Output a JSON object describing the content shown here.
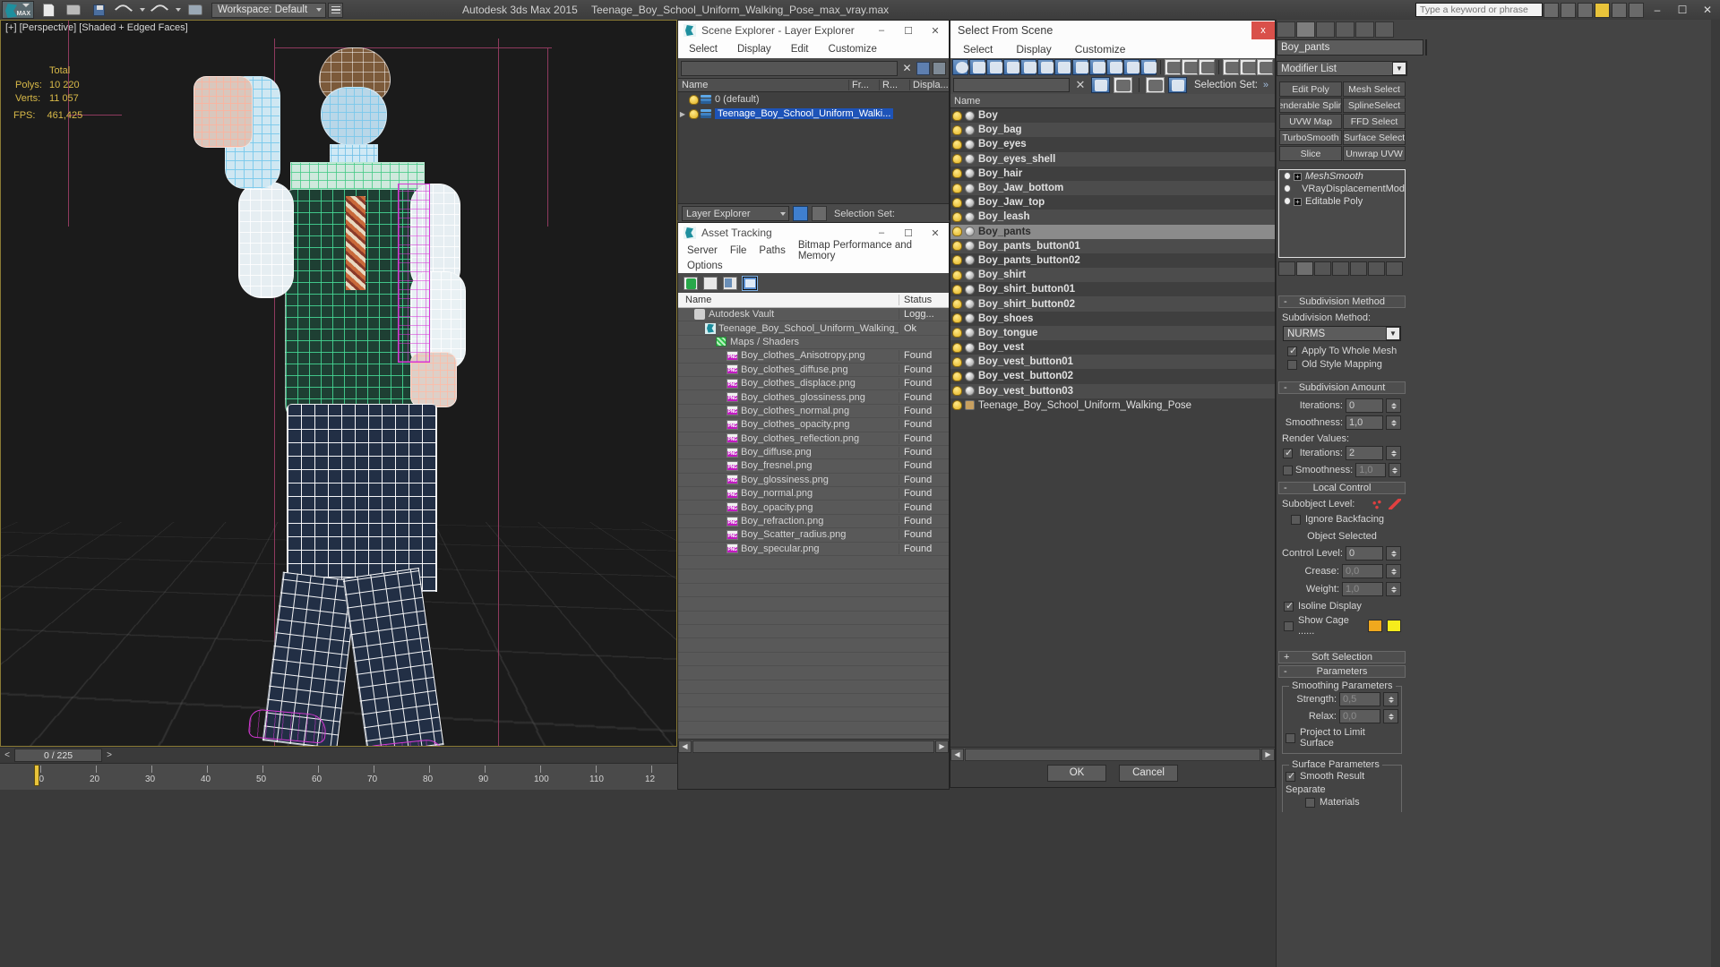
{
  "app": {
    "title": "Autodesk 3ds Max  2015",
    "file": "Teenage_Boy_School_Uniform_Walking_Pose_max_vray.max",
    "workspace_label": "Workspace: Default",
    "keyword_placeholder": "Type a keyword or phrase",
    "win_min": "–",
    "win_max": "☐",
    "win_close": "✕"
  },
  "viewport": {
    "label": "[+] [Perspective] [Shaded + Edged Faces]",
    "stats": {
      "total_header": "Total",
      "polys_label": "Polys:",
      "polys_value": "10 220",
      "verts_label": "Verts:",
      "verts_value": "11 057",
      "fps_label": "FPS:",
      "fps_value": "461,425"
    },
    "timeline": {
      "frame_readout": "0 / 225",
      "prev": "<",
      "next": ">",
      "ticks": [
        "10",
        "20",
        "30",
        "40",
        "50",
        "60",
        "70",
        "80",
        "90",
        "100",
        "110",
        "12"
      ]
    }
  },
  "scene_explorer": {
    "title": "Scene Explorer - Layer Explorer",
    "menus": [
      "Select",
      "Display",
      "Edit",
      "Customize"
    ],
    "column_name": "Name",
    "column_fr": "Fr...",
    "column_r": "R...",
    "column_displa": "Displa...",
    "rows": [
      {
        "name": "0 (default)",
        "selected": false,
        "expandable": false
      },
      {
        "name": "Teenage_Boy_School_Uniform_Walki...",
        "selected": true,
        "expandable": true
      }
    ],
    "footer_combo": "Layer Explorer",
    "footer_selection_set": "Selection Set:",
    "win_min": "–",
    "win_max": "☐",
    "win_close": "✕"
  },
  "asset_tracking": {
    "title": "Asset Tracking",
    "menus": [
      "Server",
      "File",
      "Paths",
      "Bitmap Performance and Memory",
      "Options"
    ],
    "col_name": "Name",
    "col_status": "Status",
    "rows": [
      {
        "name": "Autodesk Vault",
        "status": "Logg...",
        "icon": "vault-icon",
        "indent": 1
      },
      {
        "name": "Teenage_Boy_School_Uniform_Walking_Pose...",
        "status": "Ok",
        "icon": "max-icon",
        "indent": 2
      },
      {
        "name": "Maps / Shaders",
        "status": "",
        "icon": "maps-icon",
        "indent": 3
      },
      {
        "name": "Boy_clothes_Anisotropy.png",
        "status": "Found",
        "icon": "png-icon",
        "indent": 4
      },
      {
        "name": "Boy_clothes_diffuse.png",
        "status": "Found",
        "icon": "png-icon",
        "indent": 4
      },
      {
        "name": "Boy_clothes_displace.png",
        "status": "Found",
        "icon": "png-icon",
        "indent": 4
      },
      {
        "name": "Boy_clothes_glossiness.png",
        "status": "Found",
        "icon": "png-icon",
        "indent": 4
      },
      {
        "name": "Boy_clothes_normal.png",
        "status": "Found",
        "icon": "png-icon",
        "indent": 4
      },
      {
        "name": "Boy_clothes_opacity.png",
        "status": "Found",
        "icon": "png-icon",
        "indent": 4
      },
      {
        "name": "Boy_clothes_reflection.png",
        "status": "Found",
        "icon": "png-icon",
        "indent": 4
      },
      {
        "name": "Boy_diffuse.png",
        "status": "Found",
        "icon": "png-icon",
        "indent": 4
      },
      {
        "name": "Boy_fresnel.png",
        "status": "Found",
        "icon": "png-icon",
        "indent": 4
      },
      {
        "name": "Boy_glossiness.png",
        "status": "Found",
        "icon": "png-icon",
        "indent": 4
      },
      {
        "name": "Boy_normal.png",
        "status": "Found",
        "icon": "png-icon",
        "indent": 4
      },
      {
        "name": "Boy_opacity.png",
        "status": "Found",
        "icon": "png-icon",
        "indent": 4
      },
      {
        "name": "Boy_refraction.png",
        "status": "Found",
        "icon": "png-icon",
        "indent": 4
      },
      {
        "name": "Boy_Scatter_radius.png",
        "status": "Found",
        "icon": "png-icon",
        "indent": 4
      },
      {
        "name": "Boy_specular.png",
        "status": "Found",
        "icon": "png-icon",
        "indent": 4
      }
    ],
    "win_min": "–",
    "win_max": "☐",
    "win_close": "✕"
  },
  "select_from_scene": {
    "title": "Select From Scene",
    "close": "x",
    "menus": [
      "Select",
      "Display",
      "Customize"
    ],
    "selection_set_label": "Selection Set:",
    "overflow": "»",
    "column_name": "Name",
    "objects": [
      {
        "name": "Boy",
        "selected": false
      },
      {
        "name": "Boy_bag",
        "selected": false
      },
      {
        "name": "Boy_eyes",
        "selected": false
      },
      {
        "name": "Boy_eyes_shell",
        "selected": false
      },
      {
        "name": "Boy_hair",
        "selected": false
      },
      {
        "name": "Boy_Jaw_bottom",
        "selected": false
      },
      {
        "name": "Boy_Jaw_top",
        "selected": false
      },
      {
        "name": "Boy_leash",
        "selected": false
      },
      {
        "name": "Boy_pants",
        "selected": true
      },
      {
        "name": "Boy_pants_button01",
        "selected": false
      },
      {
        "name": "Boy_pants_button02",
        "selected": false
      },
      {
        "name": "Boy_shirt",
        "selected": false
      },
      {
        "name": "Boy_shirt_button01",
        "selected": false
      },
      {
        "name": "Boy_shirt_button02",
        "selected": false
      },
      {
        "name": "Boy_shoes",
        "selected": false
      },
      {
        "name": "Boy_tongue",
        "selected": false
      },
      {
        "name": "Boy_vest",
        "selected": false
      },
      {
        "name": "Boy_vest_button01",
        "selected": false
      },
      {
        "name": "Boy_vest_button02",
        "selected": false
      },
      {
        "name": "Boy_vest_button03",
        "selected": false
      },
      {
        "name": "Teenage_Boy_School_Uniform_Walking_Pose",
        "selected": false,
        "is_group": true
      }
    ],
    "ok_label": "OK",
    "cancel_label": "Cancel"
  },
  "command_panel": {
    "object_name": "Boy_pants",
    "modifier_list_label": "Modifier List",
    "modifier_buttons": [
      "Edit Poly",
      "Mesh Select",
      "enderable Splin",
      "SplineSelect",
      "UVW Map",
      "FFD Select",
      "TurboSmooth",
      "Surface Select",
      "Slice",
      "Unwrap UVW"
    ],
    "modifier_stack": [
      {
        "name": "MeshSmooth",
        "italic": true,
        "has_plus": true
      },
      {
        "name": "VRayDisplacementMod",
        "italic": false,
        "has_plus": false
      },
      {
        "name": "Editable Poly",
        "italic": false,
        "has_plus": true
      }
    ],
    "subdivision_method": {
      "header": "Subdivision Method",
      "collapse": "-",
      "label": "Subdivision Method:",
      "value": "NURMS",
      "apply_whole_mesh": {
        "label": "Apply To Whole Mesh",
        "checked": true
      },
      "old_style_mapping": {
        "label": "Old Style Mapping",
        "checked": false
      }
    },
    "subdivision_amount": {
      "header": "Subdivision Amount",
      "collapse": "-",
      "iterations_label": "Iterations:",
      "iterations_value": "0",
      "smoothness_label": "Smoothness:",
      "smoothness_value": "1,0",
      "render_values_label": "Render Values:",
      "render_iterations_label": "Iterations:",
      "render_iterations_value": "2",
      "render_iterations_checked": true,
      "render_smoothness_label": "Smoothness:",
      "render_smoothness_value": "1,0",
      "render_smoothness_checked": false
    },
    "local_control": {
      "header": "Local Control",
      "collapse": "-",
      "subobject_label": "Subobject Level:",
      "ignore_backfacing": {
        "label": "Ignore Backfacing",
        "checked": false
      },
      "object_selected": "Object Selected",
      "control_level_label": "Control Level:",
      "control_level_value": "0",
      "crease_label": "Crease:",
      "crease_value": "0,0",
      "weight_label": "Weight:",
      "weight_value": "1,0",
      "isoline_display": {
        "label": "Isoline Display",
        "checked": true
      },
      "show_cage": {
        "label": "Show Cage ......",
        "checked": false
      },
      "cage_color_1": "#f0a81e",
      "cage_color_2": "#f5ec1c"
    },
    "soft_selection": {
      "header": "Soft Selection",
      "collapse": "+"
    },
    "parameters": {
      "header": "Parameters",
      "collapse": "-",
      "smoothing_group": "Smoothing Parameters",
      "strength_label": "Strength:",
      "strength_value": "0,5",
      "relax_label": "Relax:",
      "relax_value": "0,0",
      "project_limit": {
        "label": "Project to Limit Surface",
        "checked": false
      },
      "surface_group": "Surface Parameters",
      "smooth_result": {
        "label": "Smooth Result",
        "checked": true
      },
      "separate_label": "Separate",
      "materials": {
        "label": "Materials",
        "checked": false
      }
    }
  }
}
